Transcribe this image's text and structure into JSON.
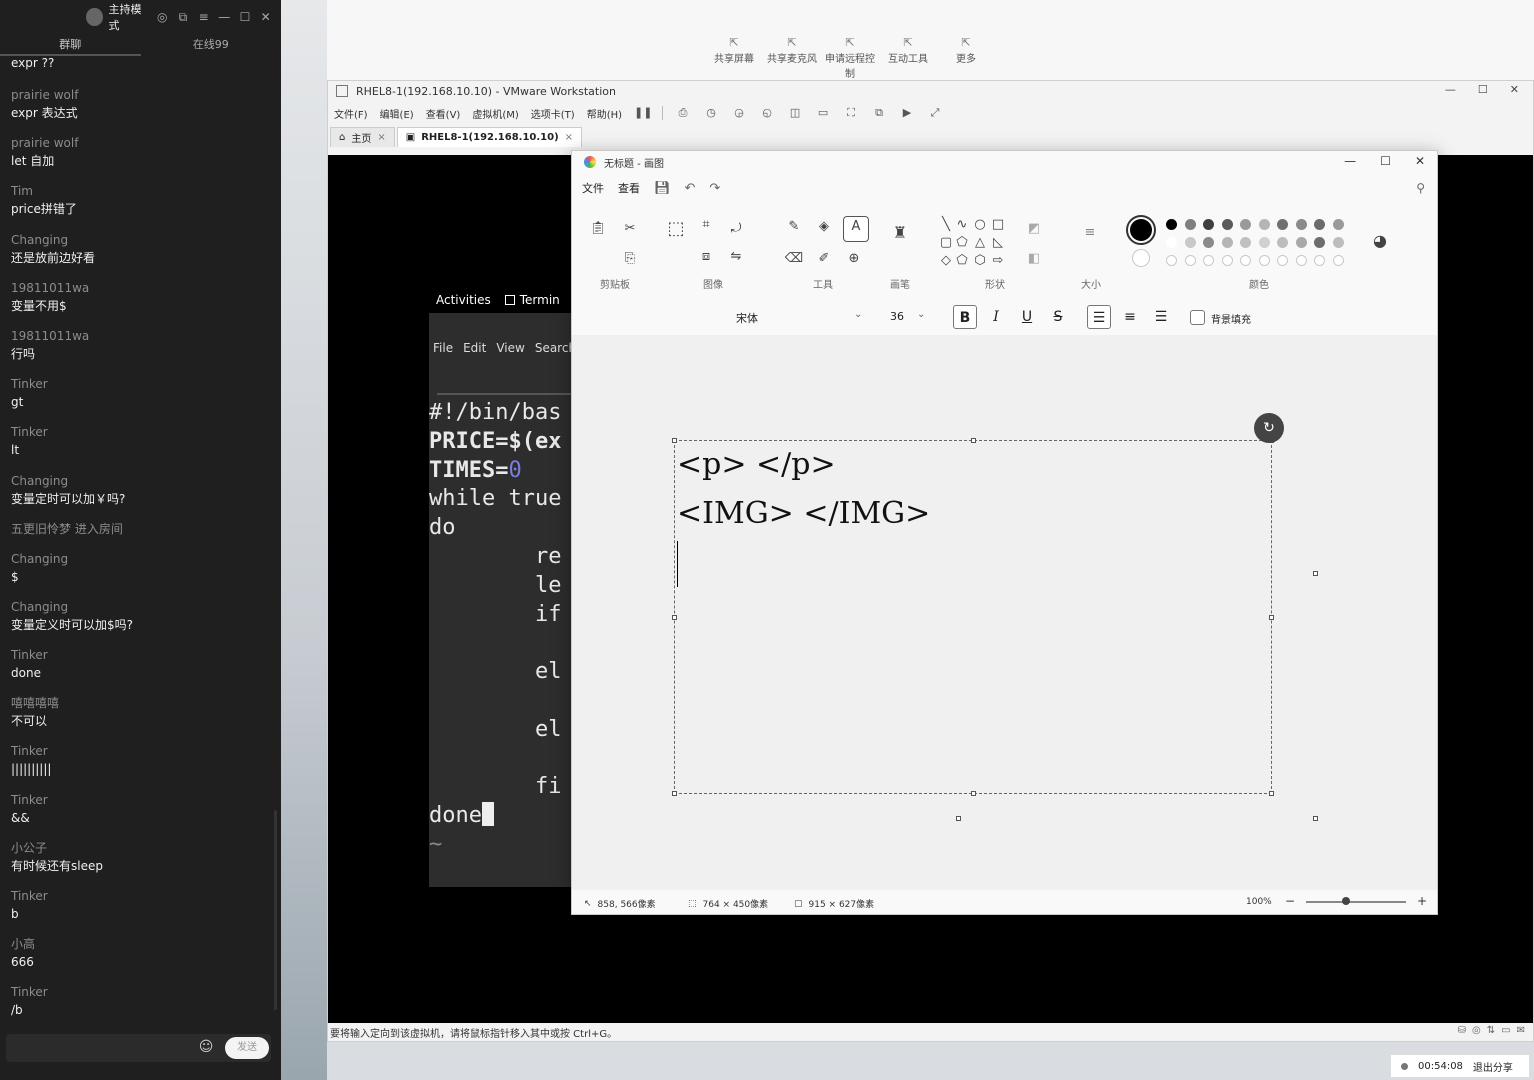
{
  "chat": {
    "mode_label": "主持模式",
    "tabs": [
      "群聊",
      "在线99"
    ],
    "first_message": "expr  ??",
    "messages": [
      {
        "who": "prairie wolf",
        "text": "expr  表达式"
      },
      {
        "who": "prairie wolf",
        "text": "let 自加"
      },
      {
        "who": "Tim",
        "text": "price拼错了"
      },
      {
        "who": "Changing",
        "text": "还是放前边好看"
      },
      {
        "who": "19811011wa",
        "text": "变量不用$"
      },
      {
        "who": "19811011wa",
        "text": "行吗"
      },
      {
        "who": "Tinker",
        "text": "gt"
      },
      {
        "who": "Tinker",
        "text": "lt"
      },
      {
        "who": "Changing",
        "text": "变量定时可以加￥吗?"
      }
    ],
    "system_notice": "五更旧怜梦 进入房间",
    "messages2": [
      {
        "who": "Changing",
        "text": "$"
      },
      {
        "who": "Changing",
        "text": "变量定义时可以加$吗?"
      },
      {
        "who": "Tinker",
        "text": "done"
      },
      {
        "who": "嘻嘻嘻嘻",
        "text": "不可以"
      },
      {
        "who": "Tinker",
        "text": "||||||||||"
      },
      {
        "who": "Tinker",
        "text": "&&"
      },
      {
        "who": "小公子",
        "text": "有时候还有sleep"
      },
      {
        "who": "Tinker",
        "text": "b"
      },
      {
        "who": "小高",
        "text": "666"
      },
      {
        "who": "Tinker",
        "text": "/b"
      }
    ],
    "send_label": "发送"
  },
  "topbar": {
    "tools": [
      "共享屏幕",
      "共享麦克风",
      "申请远程控制",
      "互动工具",
      "更多"
    ]
  },
  "vmware": {
    "title": "RHEL8-1(192.168.10.10) - VMware Workstation",
    "menu": [
      "文件(F)",
      "编辑(E)",
      "查看(V)",
      "虚拟机(M)",
      "选项卡(T)",
      "帮助(H)"
    ],
    "tabs": [
      "主页",
      "RHEL8-1(192.168.10.10)"
    ],
    "status": "要将输入定向到该虚拟机，请将鼠标指针移入其中或按 Ctrl+G。"
  },
  "gnome": {
    "activities": "Activities",
    "terminal": "Termin"
  },
  "terminal": {
    "menu": [
      "File",
      "Edit",
      "View",
      "Search"
    ],
    "lines": [
      {
        "text": "#!/bin/bas",
        "style": "plain"
      },
      {
        "text": "PRICE=$(ex",
        "style": "bold"
      },
      {
        "text": "TIMES=",
        "style": "bold",
        "num": "0"
      },
      {
        "text": "while true",
        "style": "plain"
      },
      {
        "text": "do",
        "style": "plain"
      },
      {
        "text": "        re",
        "style": "plain"
      },
      {
        "text": "        le",
        "style": "plain"
      },
      {
        "text": "        if",
        "style": "plain"
      },
      {
        "text": "",
        "style": "plain"
      },
      {
        "text": "        el",
        "style": "plain"
      },
      {
        "text": "",
        "style": "plain"
      },
      {
        "text": "        el",
        "style": "plain"
      },
      {
        "text": "",
        "style": "plain"
      },
      {
        "text": "        fi",
        "style": "plain"
      },
      {
        "text": "done",
        "style": "cursor"
      },
      {
        "text": "~",
        "style": "tilde"
      }
    ]
  },
  "paint": {
    "title": "无标题 - 画图",
    "menu": [
      "文件",
      "查看"
    ],
    "groups": [
      "剪贴板",
      "图像",
      "工具",
      "画笔",
      "形状",
      "大小",
      "颜色"
    ],
    "font": "宋体",
    "font_size": "36",
    "bg_fill_label": "背景填充",
    "text_lines": [
      "<p> </p>",
      "<IMG> </IMG>"
    ],
    "status": {
      "cursor": "858, 566像素",
      "selection": "764 × 450像素",
      "canvas": "915 × 627像素",
      "zoom": "100%"
    },
    "palette_row1": [
      "#000000",
      "#7f7f7f",
      "#3f3f3f",
      "#5a5a5a",
      "#9a9a9a",
      "#b5b5b5",
      "#707070",
      "#8a8a8a",
      "#6a6a6a",
      "#9a9a9a"
    ],
    "palette_row2": [
      "#ffffff",
      "#c8c8c8",
      "#8a8a8a",
      "#b5b5b5",
      "#c0c0c0",
      "#d0d0d0",
      "#bdbdbd",
      "#a8a8a8",
      "#6d6d6d",
      "#bdbdbd"
    ],
    "primary_color": "#000000",
    "secondary_color": "#ffffff"
  },
  "share": {
    "time": "00:54:08",
    "exit_label": "退出分享"
  }
}
